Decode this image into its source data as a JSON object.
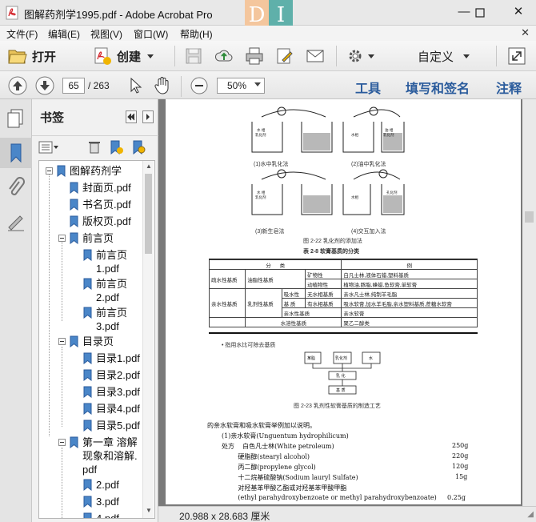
{
  "window": {
    "title": "图解药剂学1995.pdf - Adobe Acrobat Pro",
    "deco_letters": [
      "D",
      "I"
    ]
  },
  "menu": [
    "文件(F)",
    "编辑(E)",
    "视图(V)",
    "窗口(W)",
    "帮助(H)"
  ],
  "toolbar": {
    "open_label": "打开",
    "create_label": "创建",
    "customize_label": "自定义"
  },
  "nav": {
    "current_page": "65",
    "total_pages": "/ 263",
    "zoom": "50%",
    "tools_label": "工具",
    "fill_sign_label": "填写和签名",
    "comment_label": "注释"
  },
  "bookmarks": {
    "title": "书签",
    "items": [
      {
        "label": "图解药剂学",
        "level": 0,
        "expanded": true
      },
      {
        "label": "封面页.pdf",
        "level": 1
      },
      {
        "label": "书名页.pdf",
        "level": 1
      },
      {
        "label": "版权页.pdf",
        "level": 1
      },
      {
        "label": "前言页",
        "level": 1,
        "expanded": true
      },
      {
        "label": "前言页\n1.pdf",
        "level": 2
      },
      {
        "label": "前言页\n2.pdf",
        "level": 2
      },
      {
        "label": "前言页\n3.pdf",
        "level": 2
      },
      {
        "label": "目录页",
        "level": 1,
        "expanded": true
      },
      {
        "label": "目录1.pdf",
        "level": 2
      },
      {
        "label": "目录2.pdf",
        "level": 2
      },
      {
        "label": "目录3.pdf",
        "level": 2
      },
      {
        "label": "目录4.pdf",
        "level": 2
      },
      {
        "label": "目录5.pdf",
        "level": 2
      },
      {
        "label": "第一章 溶解\n现象和溶解.\npdf",
        "level": 1,
        "expanded": true
      },
      {
        "label": "2.pdf",
        "level": 2
      },
      {
        "label": "3.pdf",
        "level": 2
      },
      {
        "label": "4.pdf",
        "level": 2
      }
    ]
  },
  "status": {
    "page_size": "20.988 x 28.683 厘米"
  },
  "document": {
    "fig_labels": [
      "(1)水中乳化法",
      "(2)油中乳化法",
      "(3)新生皂法",
      "(4)交互加入法"
    ],
    "fig_2_22_caption": "图 2-22 乳化剂的添加法",
    "table_caption": "表 2-8 软膏基质的分类",
    "table": [
      [
        "分",
        "类",
        "",
        "",
        "例"
      ],
      [
        "疏水性基质",
        "油脂性基质",
        "",
        "矿物性",
        "白凡士林,液体石蜡,塑料基质"
      ],
      [
        "",
        "",
        "",
        "动植物性",
        "植物油,豚脂,蜂蜡,鱼软膏,单软膏"
      ],
      [
        "亲水性基质",
        "乳剂性基质",
        "吸水性",
        "无水相基质",
        "亲水凡士林,纯制羊毛脂"
      ],
      [
        "",
        "",
        "基  质",
        "有水相基质",
        "吸水软膏,加水羊毛脂,亲水塑料基质,蔗糖水软膏"
      ],
      [
        "",
        "",
        "亲水性基质",
        "",
        "亲水软膏"
      ],
      [
        "",
        "水溶性基质",
        "",
        "",
        "聚乙二醇类"
      ]
    ],
    "note": "• 指用水比可除去基质",
    "flow_boxes": [
      "某脂",
      "乳化剂",
      "水",
      "乳  化",
      "基  质"
    ],
    "fig_2_23_caption": "图 2-23 乳剂性软膏基质的制造工艺",
    "body_lines": [
      "的亲水软膏和吸水软膏举例加以说明。",
      "(1)亲水软膏(Unguentum hydrophilicum)"
    ],
    "formula": [
      {
        "name": "处方    白色凡士林(White petroleum)",
        "amount": "250g"
      },
      {
        "name": "        硬脂醇(stearyl alcohol)",
        "amount": "220g"
      },
      {
        "name": "        丙二醇(propylene glycol)",
        "amount": "120g"
      },
      {
        "name": "        十二烷基硫酸钠(Sodium lauryl Sulfate)",
        "amount": "15g"
      },
      {
        "name": "        对羟基苯甲酸乙酯或对羟基苯甲酸甲酯",
        "amount": ""
      },
      {
        "name": "        (ethyl parahydroxybenzoate or methyl parahydroxybenzoate)",
        "amount": "0.25g"
      }
    ]
  }
}
